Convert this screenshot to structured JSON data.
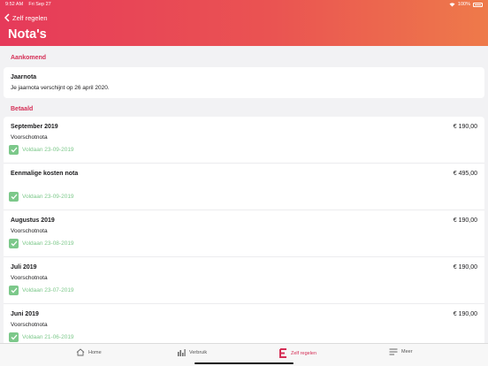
{
  "statusbar": {
    "time": "9:52 AM",
    "date": "Fri Sep 27",
    "battery": "100%"
  },
  "header": {
    "back_label": "Zelf regelen",
    "title": "Nota's"
  },
  "upcoming": {
    "section_label": "Aankomend",
    "item": {
      "title": "Jaarnota",
      "description": "Je jaarnota verschijnt op 26 april 2020."
    }
  },
  "paid": {
    "section_label": "Betaald",
    "rows": [
      {
        "title": "September 2019",
        "amount": "€ 190,00",
        "subtitle": "Voorschotnota",
        "status": "Voldaan 23-09-2019"
      },
      {
        "title": "Eenmalige kosten nota",
        "amount": "€ 495,00",
        "subtitle": "",
        "status": "Voldaan 23-09-2019"
      },
      {
        "title": "Augustus 2019",
        "amount": "€ 190,00",
        "subtitle": "Voorschotnota",
        "status": "Voldaan 23-08-2019"
      },
      {
        "title": "Juli 2019",
        "amount": "€ 190,00",
        "subtitle": "Voorschotnota",
        "status": "Voldaan 23-07-2019"
      },
      {
        "title": "Juni 2019",
        "amount": "€ 190,00",
        "subtitle": "Voorschotnota",
        "status": "Voldaan 21-06-2019"
      }
    ]
  },
  "tabbar": {
    "tabs": [
      {
        "label": "Home",
        "icon": "home-icon"
      },
      {
        "label": "Verbruik",
        "icon": "bar-chart-icon"
      },
      {
        "label": "Zelf regelen",
        "icon": "e-logo-icon"
      },
      {
        "label": "Meer",
        "icon": "menu-icon"
      }
    ],
    "active": "Zelf regelen"
  },
  "colors": {
    "brand": "#e63a5a",
    "brand_end": "#ee7a4a",
    "success": "#7cc88a"
  }
}
